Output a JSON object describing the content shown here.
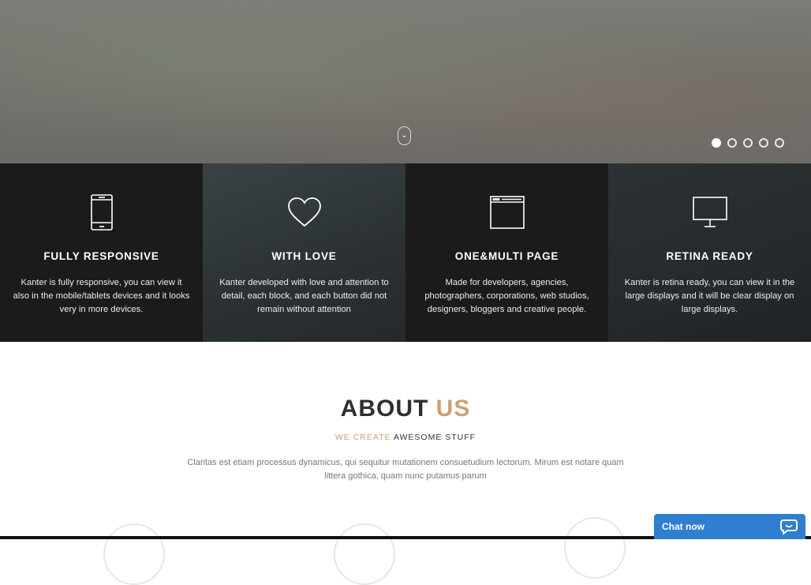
{
  "hero": {
    "scroll_icon": "chevron-down-icon",
    "slider_dots": 5,
    "active_dot": 1
  },
  "features": [
    {
      "icon": "mobile-phone-icon",
      "title": "FULLY RESPONSIVE",
      "text": "Kanter is fully responsive, you can view it also in the mobile/tablets devices and it looks very in more devices."
    },
    {
      "icon": "heart-icon",
      "title": "WITH LOVE",
      "text": "Kanter developed with love and attention to detail, each block, and each button did not remain without attention"
    },
    {
      "icon": "browser-window-icon",
      "title": "ONE&MULTI PAGE",
      "text": "Made for developers, agencies, photographers, corporations, web studios, designers, bloggers and creative people."
    },
    {
      "icon": "monitor-icon",
      "title": "RETINA READY",
      "text": "Kanter is retina ready, you can view it in the large displays and it will be clear display on large displays."
    }
  ],
  "about": {
    "title_main": "ABOUT",
    "title_accent": "US",
    "subtitle_accent": "WE CREATE",
    "subtitle_rest": "AWESOME STUFF",
    "description": "Claritas est etiam processus dynamicus, qui sequitur mutationem consuetudium lectorum. Mirum est notare quam littera gothica, quam nunc putamus parum"
  },
  "chat": {
    "label": "Chat now",
    "icon": "chat-bubble-icon"
  },
  "colors": {
    "accent": "#c9a172",
    "chat": "#2f7fd0",
    "dark_panel": "#1b1b1c"
  }
}
